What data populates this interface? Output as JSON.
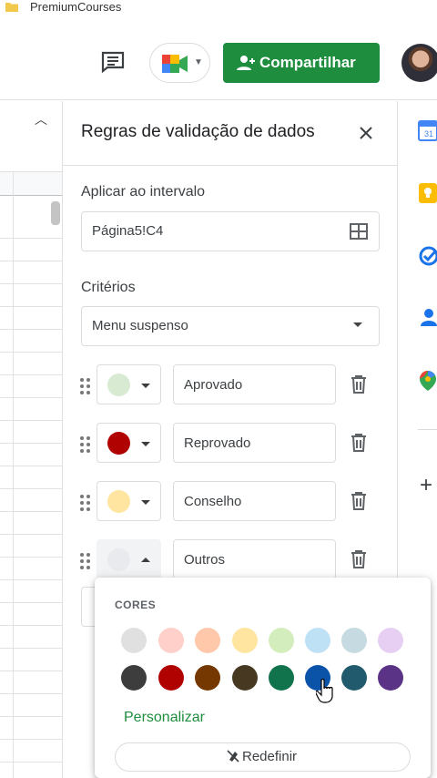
{
  "window": {
    "title": "PremiumCourses"
  },
  "toolbar": {
    "share_label": "Compartilhar"
  },
  "panel": {
    "title": "Regras de validação de dados",
    "range_label": "Aplicar ao intervalo",
    "range_value": "Página5!C4",
    "criteria_label": "Critérios",
    "criteria_value": "Menu suspenso",
    "options": [
      {
        "label": "Aprovado",
        "color": "#d9ead3"
      },
      {
        "label": "Reprovado",
        "color": "#b10202"
      },
      {
        "label": "Conselho",
        "color": "#ffe5a0"
      },
      {
        "label": "Outros",
        "color": "#e8eaed"
      }
    ]
  },
  "color_picker": {
    "section_label": "CORES",
    "row1": [
      "#e0e0e0",
      "#ffcfc9",
      "#ffc8aa",
      "#ffe5a0",
      "#d4edbc",
      "#bfe1f6",
      "#c6dbe1",
      "#e6cff2"
    ],
    "row2": [
      "#3d3d3d",
      "#b10202",
      "#753800",
      "#473821",
      "#11734b",
      "#0a53a8",
      "#215a6c",
      "#5a3286"
    ],
    "custom_label": "Personalizar",
    "reset_label": "Redefinir"
  }
}
